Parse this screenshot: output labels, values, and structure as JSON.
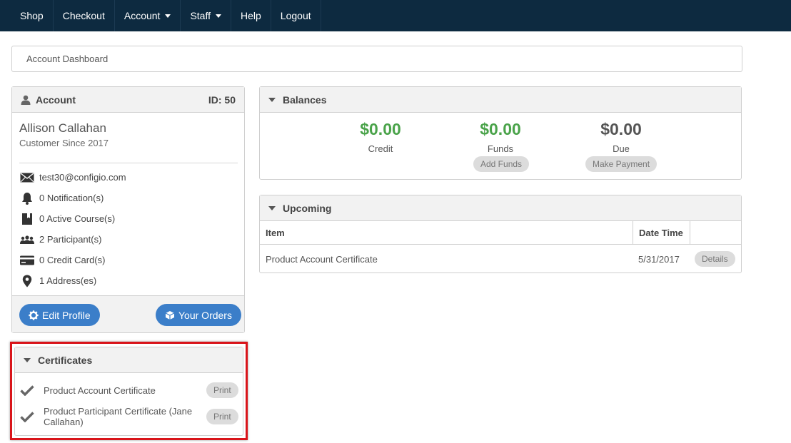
{
  "nav": {
    "items": [
      {
        "label": "Shop",
        "dropdown": false
      },
      {
        "label": "Checkout",
        "dropdown": false
      },
      {
        "label": "Account",
        "dropdown": true
      },
      {
        "label": "Staff",
        "dropdown": true
      },
      {
        "label": "Help",
        "dropdown": false
      },
      {
        "label": "Logout",
        "dropdown": false
      }
    ]
  },
  "breadcrumb": "Account Dashboard",
  "account": {
    "title": "Account",
    "id_label": "ID: 50",
    "name": "Allison Callahan",
    "since": "Customer Since 2017",
    "rows": [
      {
        "icon": "envelope-icon",
        "text": "test30@configio.com"
      },
      {
        "icon": "bell-icon",
        "text": "0 Notification(s)"
      },
      {
        "icon": "book-icon",
        "text": "0 Active Course(s)"
      },
      {
        "icon": "people-icon",
        "text": "2 Participant(s)"
      },
      {
        "icon": "credit-card-icon",
        "text": "0 Credit Card(s)"
      },
      {
        "icon": "map-pin-icon",
        "text": "1 Address(es)"
      }
    ],
    "edit_profile": "Edit Profile",
    "your_orders": "Your Orders"
  },
  "certificates": {
    "title": "Certificates",
    "items": [
      {
        "label": "Product Account Certificate",
        "action": "Print"
      },
      {
        "label": "Product Participant Certificate (Jane Callahan)",
        "action": "Print"
      }
    ]
  },
  "balances": {
    "title": "Balances",
    "credit": {
      "amount": "$0.00",
      "label": "Credit"
    },
    "funds": {
      "amount": "$0.00",
      "label": "Funds",
      "action": "Add Funds"
    },
    "due": {
      "amount": "$0.00",
      "label": "Due",
      "action": "Make Payment"
    }
  },
  "upcoming": {
    "title": "Upcoming",
    "columns": [
      "Item",
      "Date Time",
      ""
    ],
    "rows": [
      {
        "item": "Product Account Certificate",
        "date": "5/31/2017",
        "action": "Details"
      }
    ]
  },
  "colors": {
    "navbar": "#0d2a40",
    "primary_button": "#3b7ec9",
    "positive_amount": "#4aa34a",
    "highlight_border": "#d9141a"
  }
}
